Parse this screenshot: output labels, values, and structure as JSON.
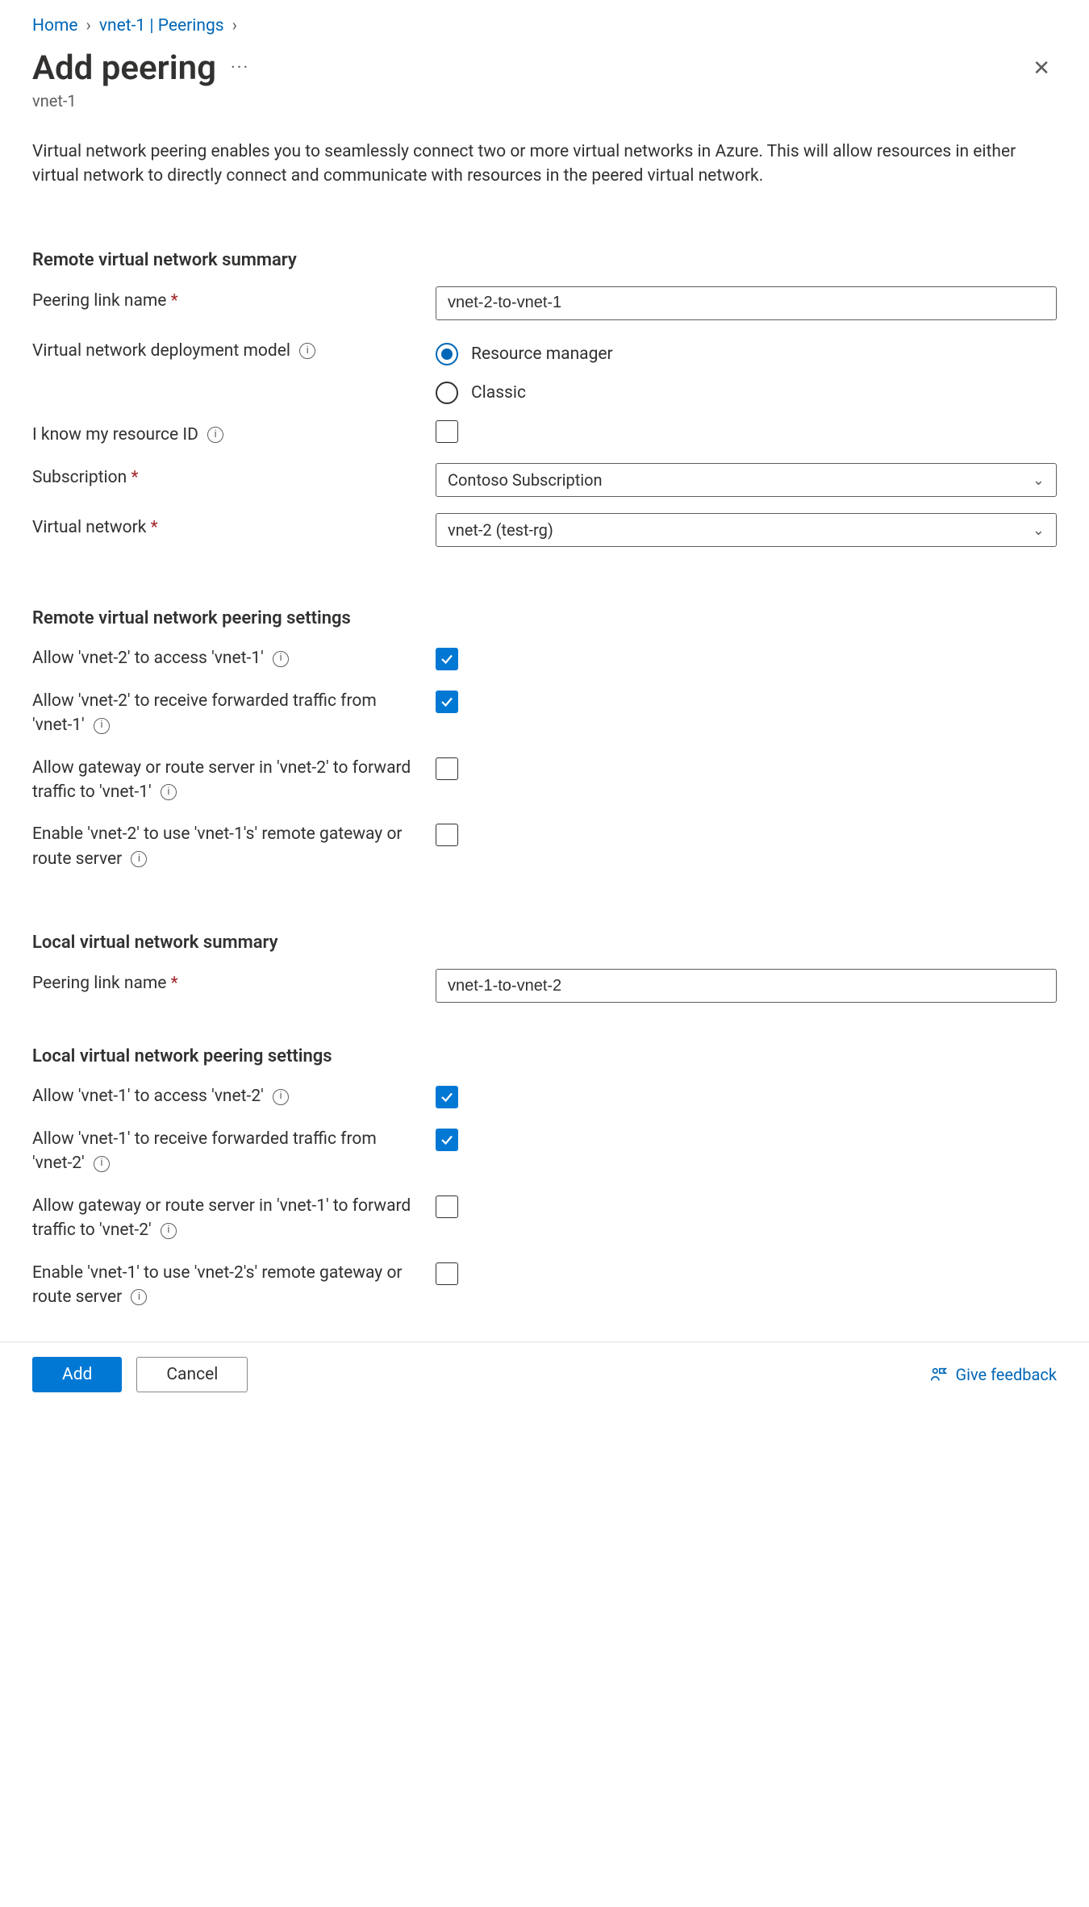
{
  "breadcrumbs": {
    "home": "Home",
    "vnet": "vnet-1 | Peerings"
  },
  "header": {
    "title": "Add peering",
    "subtitle": "vnet-1"
  },
  "intro": "Virtual network peering enables you to seamlessly connect two or more virtual networks in Azure. This will allow resources in either virtual network to directly connect and communicate with resources in the peered virtual network.",
  "remoteSummary": {
    "heading": "Remote virtual network summary",
    "peeringLinkLabel": "Peering link name",
    "peeringLinkValue": "vnet-2-to-vnet-1",
    "deploymentModelLabel": "Virtual network deployment model",
    "radioResourceManager": "Resource manager",
    "radioClassic": "Classic",
    "knowResourceIdLabel": "I know my resource ID",
    "subscriptionLabel": "Subscription",
    "subscriptionValue": "Contoso Subscription",
    "vnetLabel": "Virtual network",
    "vnetValue": "vnet-2 (test-rg)"
  },
  "remoteSettings": {
    "heading": "Remote virtual network peering settings",
    "allowAccess": "Allow 'vnet-2' to access 'vnet-1'",
    "allowForwarded": "Allow 'vnet-2' to receive forwarded traffic from 'vnet-1'",
    "allowGateway": "Allow gateway or route server in 'vnet-2' to forward traffic to 'vnet-1'",
    "useRemoteGateway": "Enable 'vnet-2' to use 'vnet-1's' remote gateway or route server"
  },
  "localSummary": {
    "heading": "Local virtual network summary",
    "peeringLinkLabel": "Peering link name",
    "peeringLinkValue": "vnet-1-to-vnet-2"
  },
  "localSettings": {
    "heading": "Local virtual network peering settings",
    "allowAccess": "Allow 'vnet-1' to access 'vnet-2'",
    "allowForwarded": "Allow 'vnet-1' to receive forwarded traffic from 'vnet-2'",
    "allowGateway": "Allow gateway or route server in 'vnet-1' to forward traffic to 'vnet-2'",
    "useRemoteGateway": "Enable 'vnet-1' to use 'vnet-2's' remote gateway or route server"
  },
  "footer": {
    "add": "Add",
    "cancel": "Cancel",
    "feedback": "Give feedback"
  }
}
